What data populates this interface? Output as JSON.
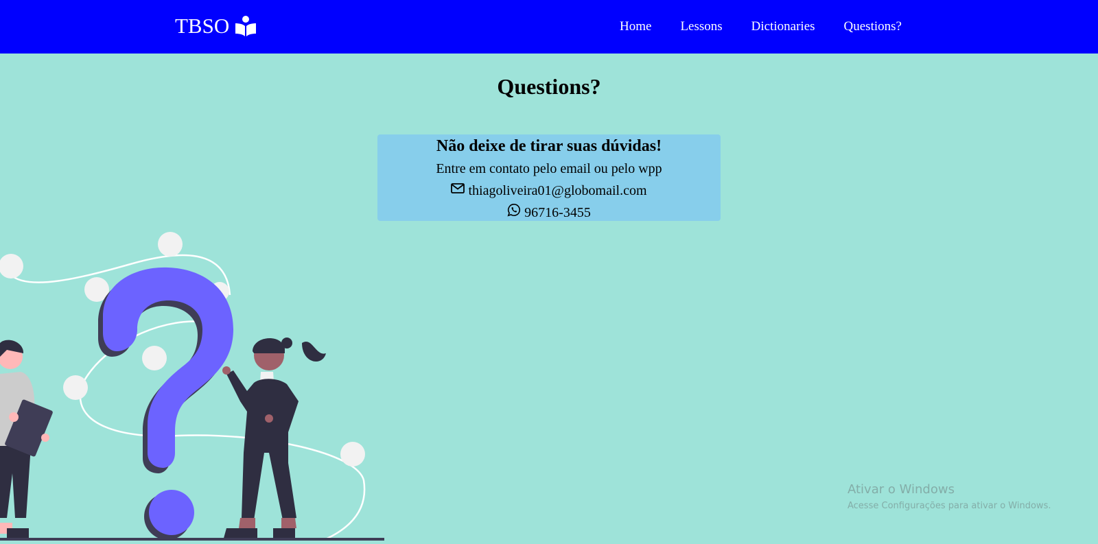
{
  "nav": {
    "brand": "TBSO",
    "brand_icon": "book-reader-icon",
    "links": [
      {
        "label": "Home"
      },
      {
        "label": "Lessons"
      },
      {
        "label": "Dictionaries"
      },
      {
        "label": "Questions?"
      }
    ]
  },
  "main": {
    "title": "Questions?",
    "card": {
      "heading": "Não deixe de tirar suas dúvidas!",
      "subtitle": "Entre em contato pelo email ou pelo wpp",
      "email": "thiagoliveira01@globomail.com",
      "email_icon": "envelope-icon",
      "phone": "96716-3455",
      "phone_icon": "whatsapp-icon"
    },
    "illustration": "questions-people-illustration"
  },
  "os_overlay": {
    "title": "Ativar o Windows",
    "subtitle": "Acesse Configurações para ativar o Windows."
  },
  "colors": {
    "navbar": "#0000ff",
    "background": "#9ee3d9",
    "card": "#87ceeb",
    "accent_purple": "#6c63ff",
    "figure_dark": "#2f2e41"
  }
}
